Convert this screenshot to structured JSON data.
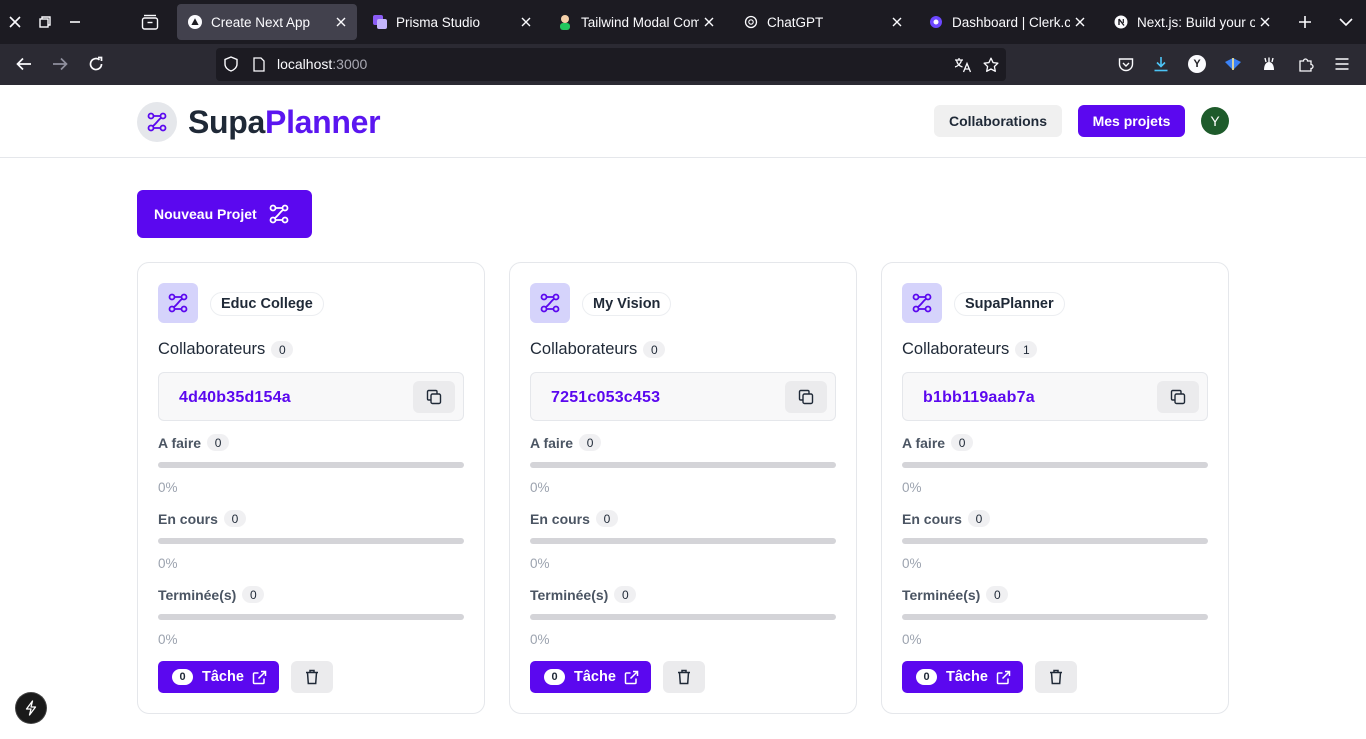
{
  "browser": {
    "tabs": [
      {
        "title": "Create Next App",
        "active": true
      },
      {
        "title": "Prisma Studio",
        "active": false
      },
      {
        "title": "Tailwind Modal Comp",
        "active": false
      },
      {
        "title": "ChatGPT",
        "active": false
      },
      {
        "title": "Dashboard | Clerk.co",
        "active": false
      },
      {
        "title": "Next.js: Build your ow",
        "active": false
      }
    ],
    "url_host": "localhost",
    "url_port": ":3000",
    "profile_letter": "Y"
  },
  "header": {
    "brand_part1": "Supa",
    "brand_part2": "Planner",
    "collab_label": "Collaborations",
    "projects_label": "Mes projets",
    "avatar_letter": "Y"
  },
  "main": {
    "new_project_label": "Nouveau Projet"
  },
  "labels": {
    "collaborators": "Collaborateurs",
    "todo": "A faire",
    "in_progress": "En cours",
    "done": "Terminée(s)",
    "task": "Tâche"
  },
  "projects": [
    {
      "name": "Educ College",
      "collaborators": "0",
      "code": "4d40b35d154a",
      "todo": {
        "count": "0",
        "percent": "0%",
        "fraction": 0
      },
      "in_progress": {
        "count": "0",
        "percent": "0%",
        "fraction": 0
      },
      "done": {
        "count": "0",
        "percent": "0%",
        "fraction": 0
      },
      "task_count": "0"
    },
    {
      "name": "My Vision",
      "collaborators": "0",
      "code": "7251c053c453",
      "todo": {
        "count": "0",
        "percent": "0%",
        "fraction": 0
      },
      "in_progress": {
        "count": "0",
        "percent": "0%",
        "fraction": 0
      },
      "done": {
        "count": "0",
        "percent": "0%",
        "fraction": 0
      },
      "task_count": "0"
    },
    {
      "name": "SupaPlanner",
      "collaborators": "1",
      "code": "b1bb119aab7a",
      "todo": {
        "count": "0",
        "percent": "0%",
        "fraction": 0
      },
      "in_progress": {
        "count": "0",
        "percent": "0%",
        "fraction": 0
      },
      "done": {
        "count": "0",
        "percent": "0%",
        "fraction": 0
      },
      "task_count": "0"
    }
  ],
  "colors": {
    "accent": "#5b08ef",
    "brand_dark": "#1f2937",
    "card_icon_bg": "#d5d3fb"
  },
  "icons": {
    "logo": "route-icon",
    "copy": "copy-icon",
    "external": "external-link-icon",
    "delete": "trash-icon"
  }
}
